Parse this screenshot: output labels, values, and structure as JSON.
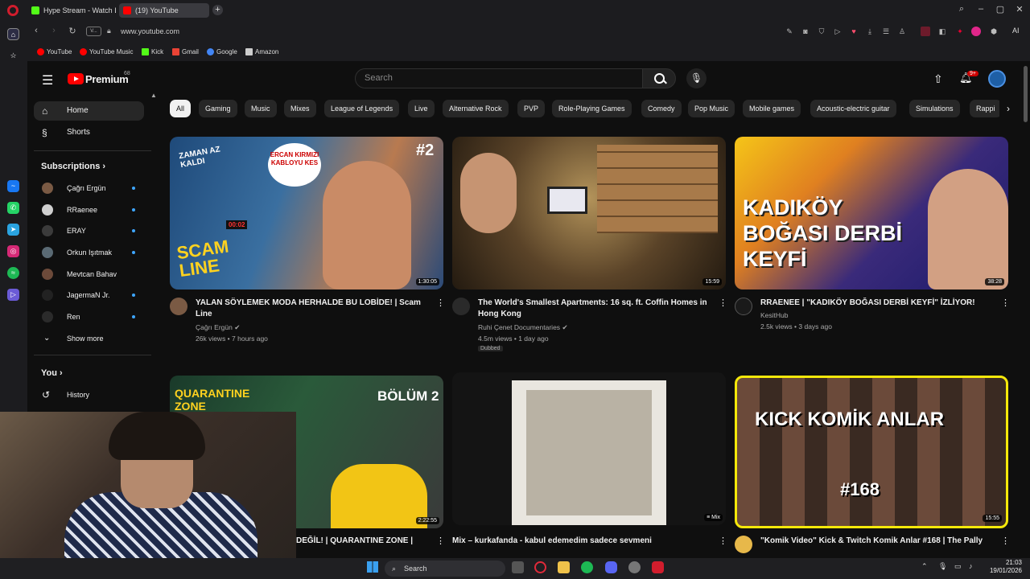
{
  "browser": {
    "tabs": [
      {
        "label": "Hype Stream - Watch Live",
        "icon": "kick-favicon",
        "color": "#53fc18"
      },
      {
        "label": "(19) YouTube",
        "icon": "youtube-favicon",
        "color": "#ff0000"
      }
    ],
    "url": "www.youtube.com",
    "url_prefix": "V...",
    "bookmarks": [
      {
        "label": "YouTube",
        "color": "#ff0000"
      },
      {
        "label": "YouTube Music",
        "color": "#ff0000"
      },
      {
        "label": "Kick",
        "color": "#53fc18"
      },
      {
        "label": "Gmail",
        "color": "#ea4335"
      },
      {
        "label": "Google",
        "color": "#4285f4"
      },
      {
        "label": "Amazon",
        "color": "#cccccc"
      }
    ],
    "ai_label": "AI"
  },
  "youtube": {
    "logo_text": "Premium",
    "logo_count": "68",
    "search_placeholder": "Search",
    "notifications": "9+",
    "sidebar": {
      "home": "Home",
      "shorts": "Shorts",
      "subscriptions_header": "Subscriptions",
      "subscriptions": [
        "Çağrı Ergün",
        "RRaenee",
        "ERAY",
        "Orkun Işıtmak",
        "Mevtcan Bahav",
        "JagermaN Jr.",
        "Ren"
      ],
      "show_more": "Show more",
      "you_header": "You",
      "history": "History"
    },
    "chips": [
      "All",
      "Gaming",
      "Music",
      "Mixes",
      "League of Legends",
      "Live",
      "Alternative Rock",
      "PVP",
      "Role-Playing Games",
      "Comedy",
      "Pop Music",
      "Mobile games",
      "Acoustic-electric guitar",
      "Simulations",
      "Rappi"
    ],
    "videos": [
      {
        "title": "YALAN SÖYLEMEK MODA HERHALDE BU LOBİDE! | Scam Line",
        "channel": "Çağrı Ergün",
        "stats": "26k views • 7 hours ago",
        "duration": "1:30:05",
        "thumb_text_1": "SCAM LINE",
        "thumb_text_2": "#2",
        "thumb_text_3": "ERCAN KIRMIZI KABLOYU KES",
        "thumb_text_4": "ZAMAN AZ KALDI",
        "thumb_text_5": "00:02",
        "verified": true
      },
      {
        "title": "The World's Smallest Apartments: 16 sq. ft. Coffin Homes in Hong Kong",
        "channel": "Ruhi Çenet Documentaries",
        "stats": "4.5m views • 1 day ago",
        "badge": "Dubbed",
        "duration": "15:59",
        "verified": true
      },
      {
        "title": "RRAENEE | \"KADIKÖY BOĞASI DERBİ KEYFİ\" İZLİYOR!",
        "channel": "KesitHub",
        "stats": "2.5k views • 3 days ago",
        "duration": "38:28",
        "thumb_text_1": "KADIKÖY BOĞASI DERBİ KEYFİ"
      },
      {
        "title": "DEĞİL! | QUARANTINE ZONE |",
        "duration": "2:22:55",
        "thumb_text_1": "QUARANTINE ZONE",
        "thumb_text_2": "BÖLÜM 2"
      },
      {
        "title": "Mix – kurkafanda - kabul edemedim sadece sevmeni",
        "duration_label": "Mix"
      },
      {
        "title": "\"Komik Video\" Kick & Twitch Komik Anlar #168 | The Pally",
        "duration": "15:55",
        "thumb_text_1": "KICK KOMİK ANLAR",
        "thumb_text_2": "#168"
      }
    ]
  },
  "taskbar": {
    "search": "Search",
    "time": "21:03",
    "date": "19/01/2026"
  }
}
